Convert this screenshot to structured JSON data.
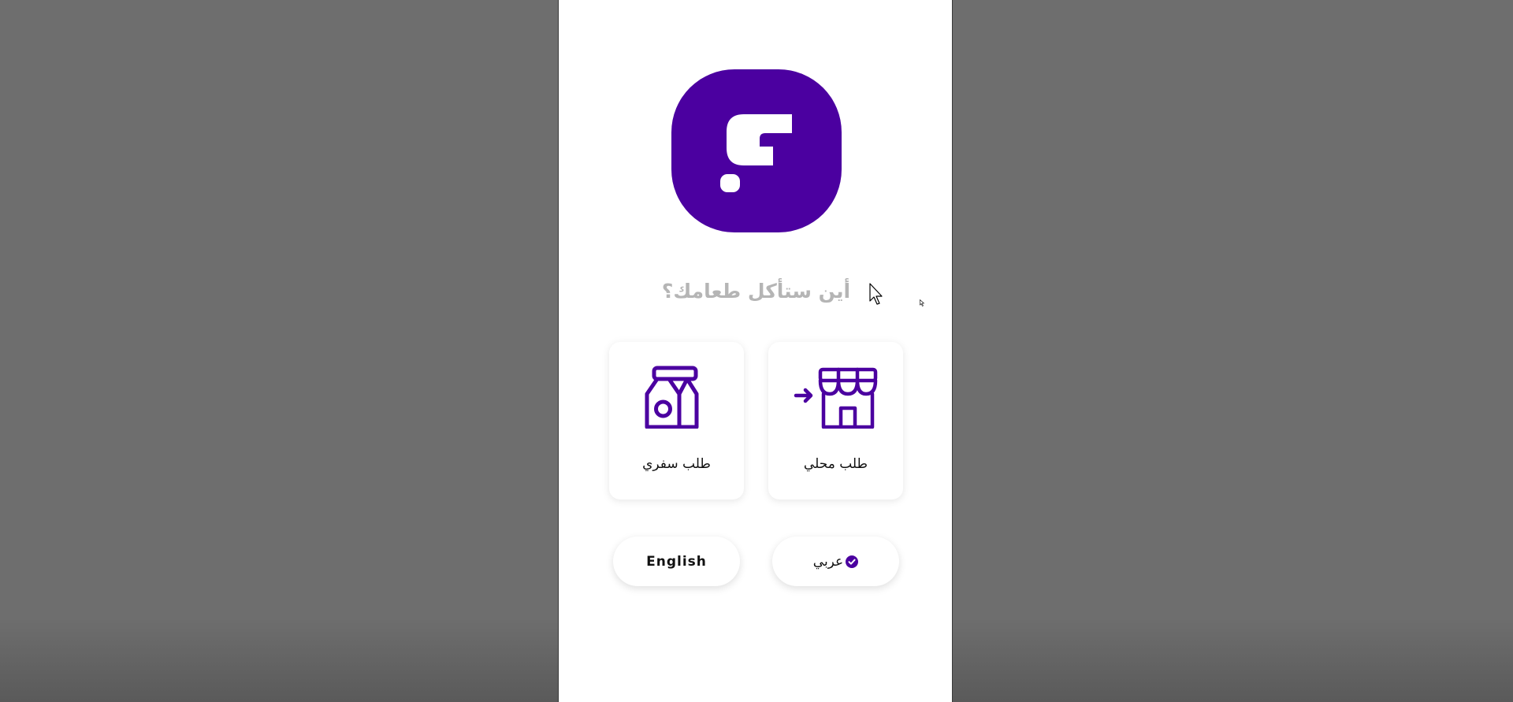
{
  "app": {
    "question": "أين ستأكل طعامك؟"
  },
  "options": [
    {
      "label": "طلب محلي",
      "icon": "store-enter-icon"
    },
    {
      "label": "طلب سفري",
      "icon": "takeaway-bag-icon"
    }
  ],
  "languages": {
    "arabic_label": "عربي",
    "english_label": "English",
    "selected": "arabic"
  },
  "colors": {
    "brand": "#4b00a0",
    "question_text": "#b5b5b5",
    "backdrop": "#6e6e6e",
    "panel": "#ffffff"
  }
}
